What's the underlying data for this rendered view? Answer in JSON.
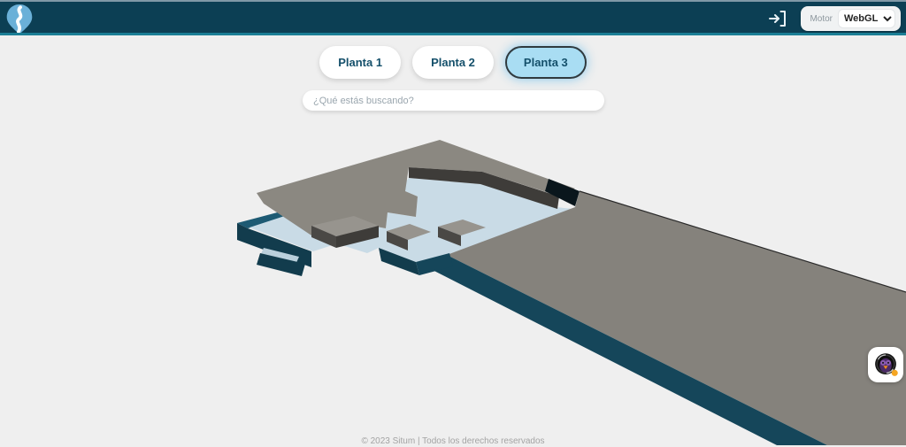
{
  "header": {
    "motor_label": "Motor",
    "engine_value": "WebGL",
    "colors": {
      "bar": "#0c3f54",
      "bottom_line": "#1b7e95",
      "logo_pin": "#6ab0d8"
    }
  },
  "floor_tabs": [
    {
      "label": "Planta 1",
      "active": false
    },
    {
      "label": "Planta 2",
      "active": false
    },
    {
      "label": "Planta 3",
      "active": true
    }
  ],
  "search": {
    "placeholder": "¿Qué estás buscando?"
  },
  "map": {
    "description": "3D render of floor plan (Planta 3)",
    "colors": {
      "roof_gray": "#8b8881",
      "roof_gray2": "#85827c",
      "roof_gray_light": "#97948e",
      "face_dark": "#3e3c39",
      "face_mid": "#4a4845",
      "teal_dark": "#123c4d",
      "teal_mid": "#15465a",
      "teal_light": "#1d5a73",
      "floor_blue": "#c9dbe6",
      "floor_blue2": "#bad0dc",
      "notch_dark": "#0a161c"
    }
  },
  "widget": {
    "badge_color": "#f5a623"
  },
  "footer": {
    "copyright": "© 2023 Situm | Todos los derechos reservados"
  }
}
